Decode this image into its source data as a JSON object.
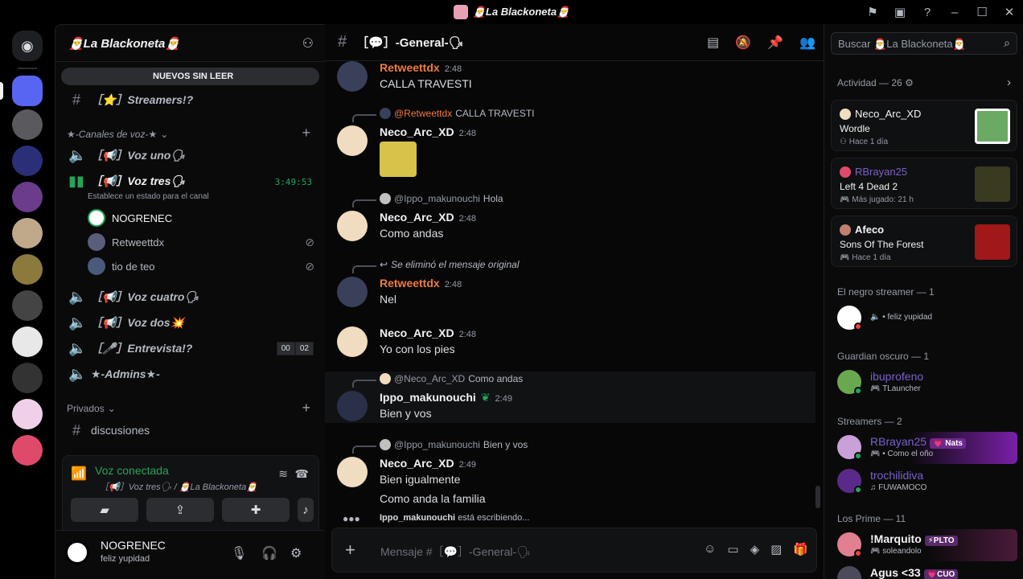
{
  "window": {
    "title": "🎅La Blackoneta🎅"
  },
  "server": {
    "name": "🎅La Blackoneta🎅",
    "unread_label": "NUEVOS SIN LEER",
    "channels": {
      "streamers": "［⭐］Streamers!?",
      "voice_category": "★-Canales de voz-★",
      "voz_uno": "［📢］Voz uno🗣",
      "voz_tres": "［📢］Voz tres🗣",
      "voz_tres_timer": "3:49:53",
      "voz_tres_status": "Establece un estado para el canal",
      "voz_cuatro": "［📢］Voz cuatro🗣",
      "voz_dos": "［📢］Voz dos💥",
      "entrevista": "［🎤］Entrevista!?",
      "entrevista_count_a": "00",
      "entrevista_count_b": "02",
      "admins": "★-Admins★-",
      "privados_category": "Privados",
      "discusiones": "discusiones"
    },
    "voice_users": [
      {
        "name": "NOGRENEC"
      },
      {
        "name": "Retweettdx"
      },
      {
        "name": "tio de teo"
      }
    ]
  },
  "voice_panel": {
    "status": "Voz conectada",
    "location": "［📢］Voz tres🗣 / 🎅La Blackoneta🎅"
  },
  "user_panel": {
    "name": "NOGRENEC",
    "status": "feliz yupidad"
  },
  "chat": {
    "channel_name": "［💬］-General-🗣",
    "messages": [
      {
        "author": "Retweettdx",
        "time": "2:48",
        "text": "CALLA TRAVESTI"
      },
      {
        "reply_to": "@Retweettdx",
        "reply_text": "CALLA TRAVESTI",
        "author": "Neco_Arc_XD",
        "time": "2:48",
        "text": ""
      },
      {
        "reply_to": "@Ippo_makunouchi",
        "reply_text": "Hola",
        "author": "Neco_Arc_XD",
        "time": "2:48",
        "text": "Como andas"
      },
      {
        "reply_to": "",
        "reply_text": "Se eliminó el mensaje original",
        "author": "Retweettdx",
        "time": "2:48",
        "text": "Nel"
      },
      {
        "author": "Neco_Arc_XD",
        "time": "2:48",
        "text": "Yo con los pies"
      },
      {
        "reply_to": "@Neco_Arc_XD",
        "reply_text": "Como andas",
        "author": "Ippo_makunouchi",
        "time": "2:49",
        "text": "Bien y vos"
      },
      {
        "reply_to": "@Ippo_makunouchi",
        "reply_text": "Bien y vos",
        "author": "Neco_Arc_XD",
        "time": "2:49",
        "text": "Bien igualmente",
        "text2": "Como anda la familia"
      }
    ],
    "typing_user": "Ippo_makunouchi",
    "typing_suffix": "está escribiendo...",
    "composer_placeholder": "Mensaje #［💬］-General-🗣"
  },
  "members_panel": {
    "search_placeholder": "Buscar 🎅La Blackoneta🎅",
    "activity_header": "Actividad — 26",
    "activities": [
      {
        "user": "Neco_Arc_XD",
        "game": "Wordle",
        "meta": "Hace 1 día"
      },
      {
        "user": "RBrayan25",
        "game": "Left 4 Dead 2",
        "meta": "Más jugado: 21 h"
      },
      {
        "user": "Afeco",
        "game": "Sons Of The Forest",
        "meta": "Hace 1 día"
      }
    ],
    "groups": [
      {
        "title": "El negro streamer — 1"
      },
      {
        "title": "Guardian oscuro — 1"
      },
      {
        "title": "Streamers — 2"
      },
      {
        "title": "Los Prime — 11"
      }
    ],
    "members": [
      {
        "name": "",
        "status": "feliz yupidad"
      },
      {
        "name": "ibuprofeno",
        "status": "TLauncher"
      },
      {
        "name": "RBrayan25",
        "tag": "Nats",
        "status": "Como el oño"
      },
      {
        "name": "trochilidiva",
        "status": "FUWAMOCO"
      },
      {
        "name": "!Marquito",
        "tag": "PLTO",
        "status": "soleandolo"
      },
      {
        "name": "Agus <33",
        "tag": "CUO",
        "status": ""
      }
    ]
  }
}
